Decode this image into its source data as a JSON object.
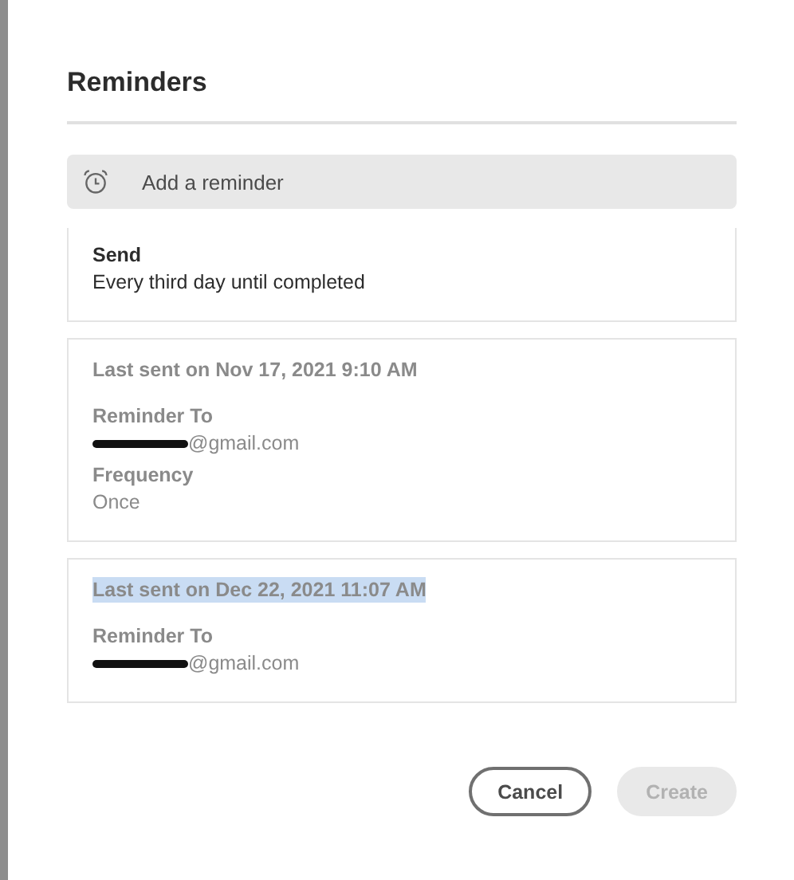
{
  "dialog": {
    "title": "Reminders",
    "add_button": {
      "label": "Add a reminder"
    },
    "reminders": [
      {
        "active": true,
        "fields": [
          {
            "label": "Send",
            "value": "Every third day until completed"
          }
        ]
      },
      {
        "active": false,
        "header": "Last sent on Nov 17, 2021 9:10 AM",
        "highlighted": false,
        "fields": [
          {
            "label": "Reminder To",
            "value": "@gmail.com",
            "redacted": true
          },
          {
            "label": "Frequency",
            "value": "Once"
          }
        ]
      },
      {
        "active": false,
        "header": "Last sent on Dec 22, 2021 11:07 AM",
        "highlighted": true,
        "fields": [
          {
            "label": "Reminder To",
            "value": "@gmail.com",
            "redacted": true
          }
        ]
      }
    ],
    "buttons": [
      {
        "label": "Cancel",
        "disabled": false
      },
      {
        "label": "Create",
        "disabled": true
      }
    ]
  }
}
